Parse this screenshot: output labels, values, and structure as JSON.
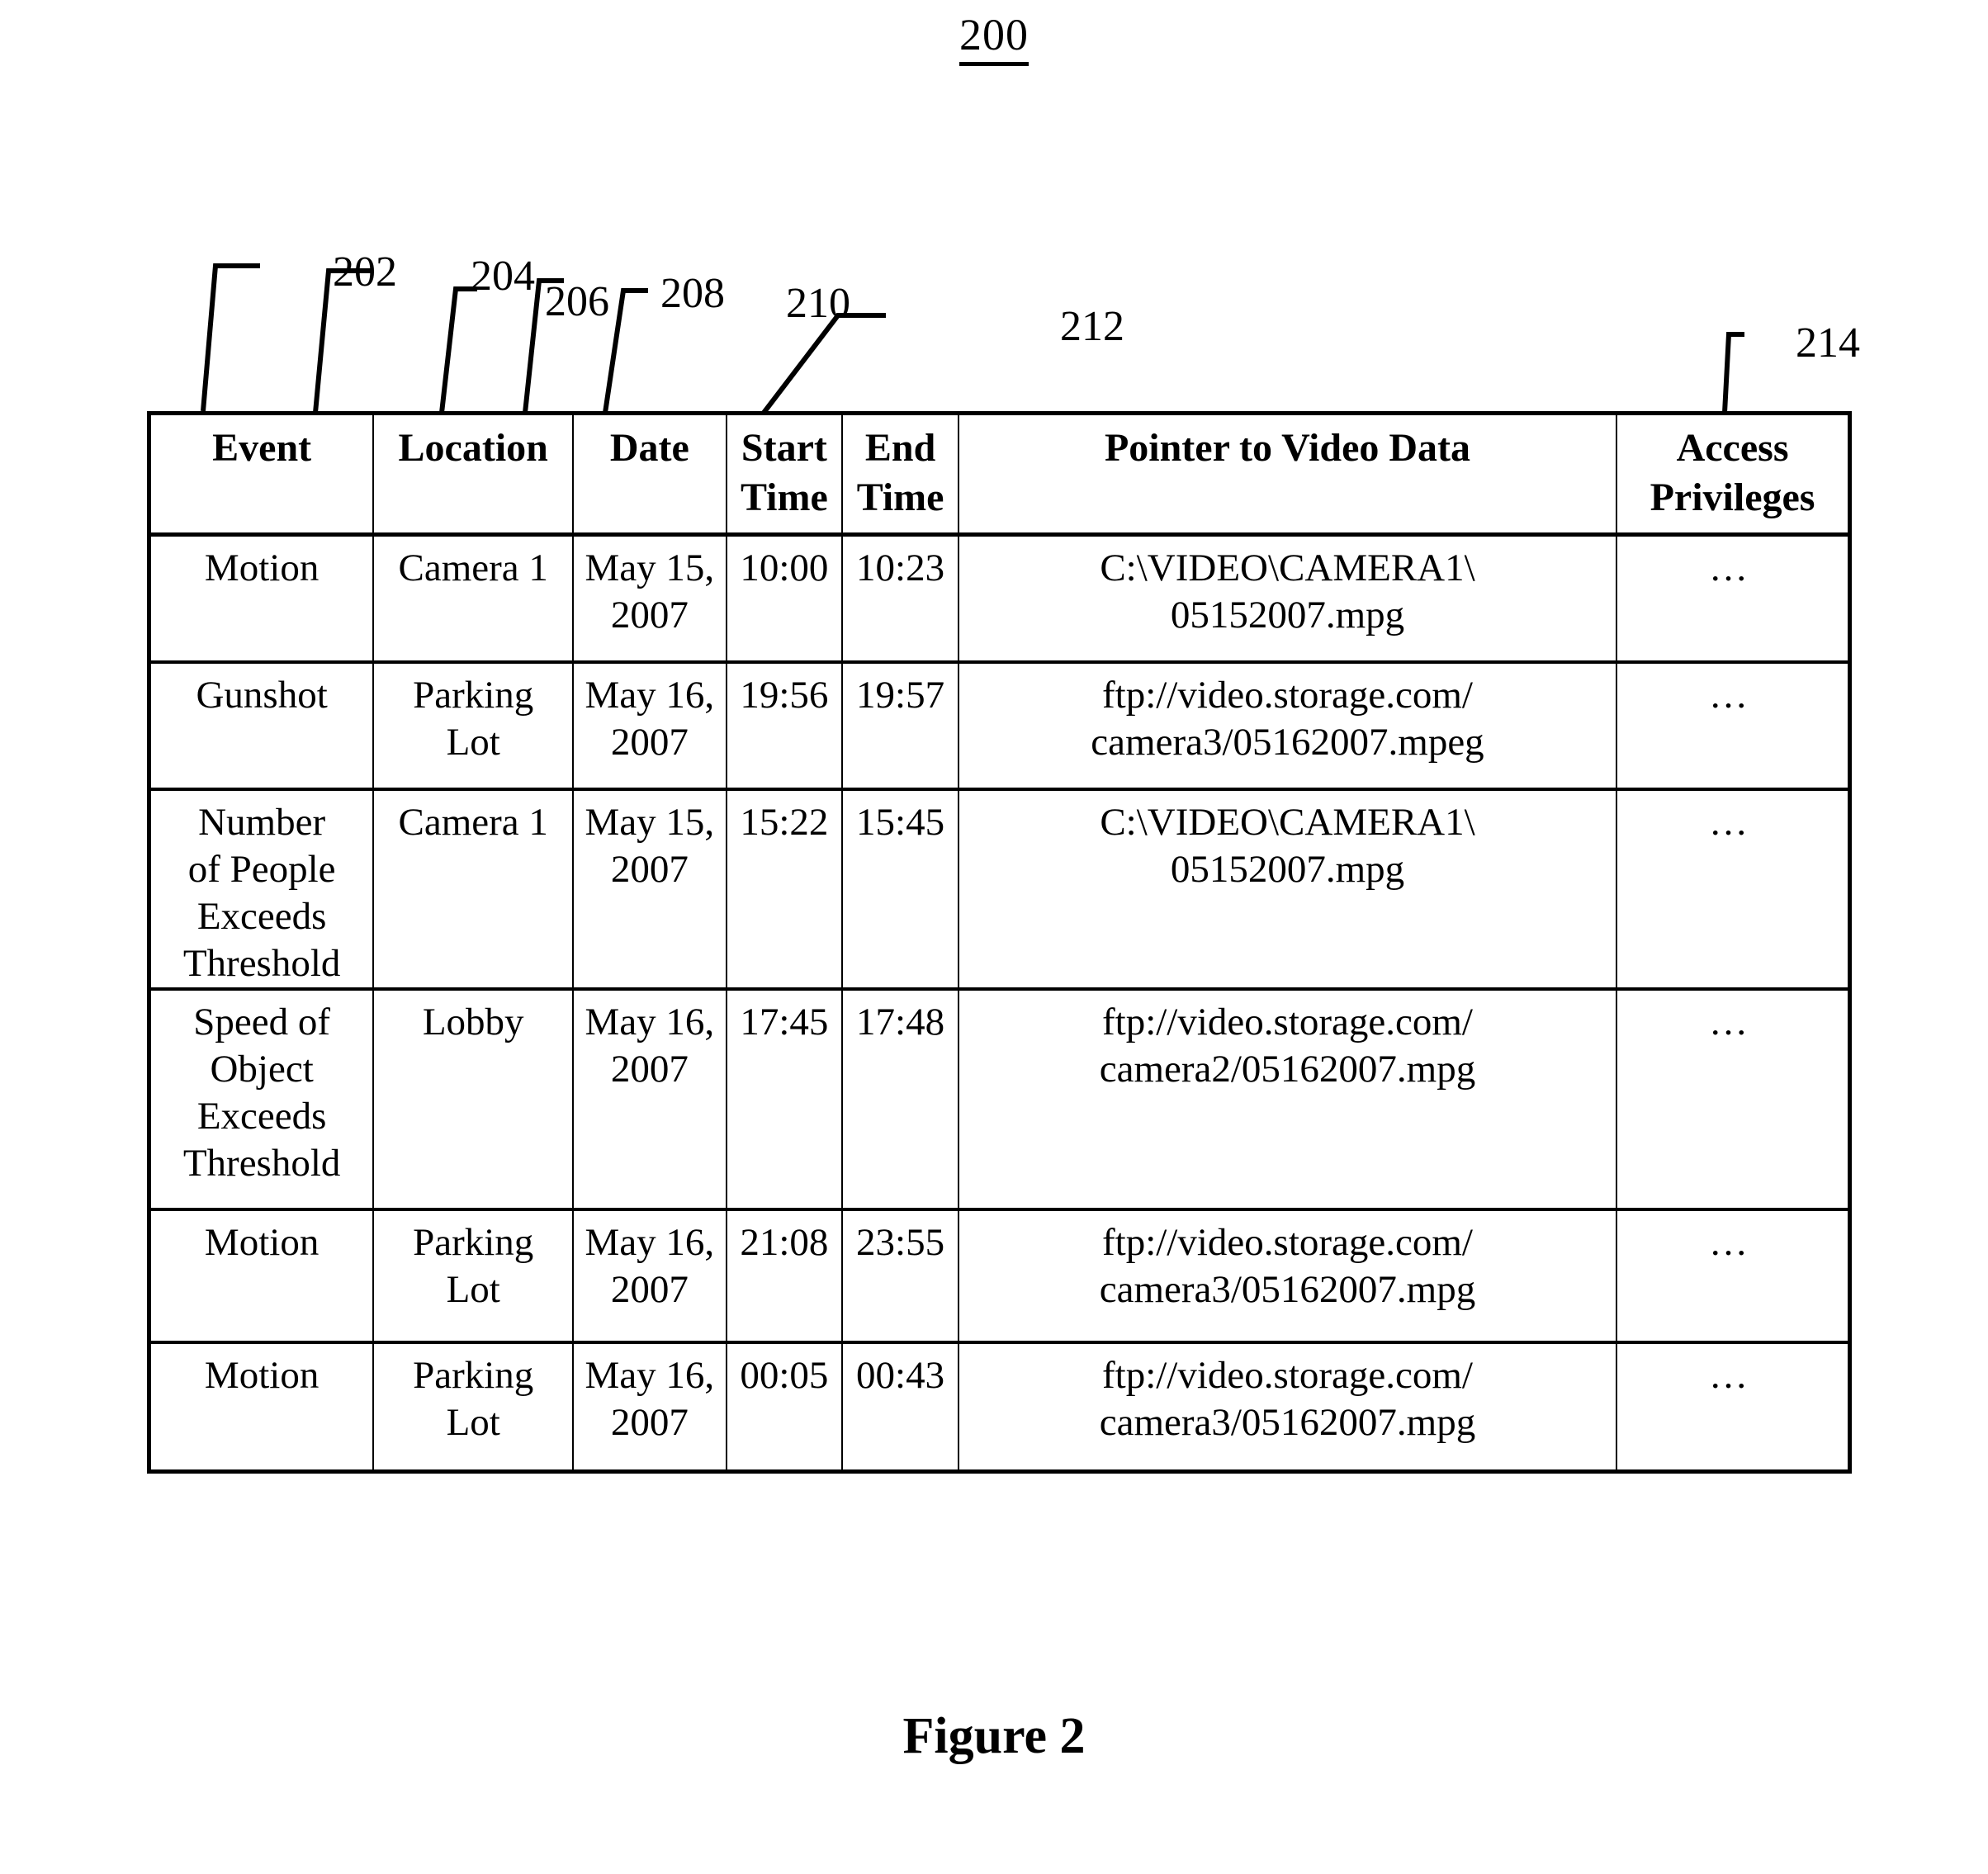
{
  "figure": {
    "number_label": "200",
    "caption": "Figure 2"
  },
  "reference_numerals": [
    {
      "id": "202",
      "label": "202"
    },
    {
      "id": "204",
      "label": "204"
    },
    {
      "id": "206",
      "label": "206"
    },
    {
      "id": "208",
      "label": "208"
    },
    {
      "id": "210",
      "label": "210"
    },
    {
      "id": "212",
      "label": "212"
    },
    {
      "id": "214",
      "label": "214"
    }
  ],
  "table": {
    "columns": [
      {
        "key": "event",
        "header_line1": "Event",
        "header_line2": ""
      },
      {
        "key": "location",
        "header_line1": "Location",
        "header_line2": ""
      },
      {
        "key": "date",
        "header_line1": "Date",
        "header_line2": ""
      },
      {
        "key": "start",
        "header_line1": "Start",
        "header_line2": "Time"
      },
      {
        "key": "end",
        "header_line1": "End",
        "header_line2": "Time"
      },
      {
        "key": "pointer",
        "header_line1": "Pointer to Video Data",
        "header_line2": ""
      },
      {
        "key": "access",
        "header_line1": "Access",
        "header_line2": "Privileges"
      }
    ],
    "rows": [
      {
        "event_lines": [
          "Motion"
        ],
        "location_lines": [
          "Camera 1"
        ],
        "date_lines": [
          "May 15,",
          "2007"
        ],
        "start": "10:00",
        "end": "10:23",
        "pointer_lines": [
          "C:\\VIDEO\\CAMERA1\\",
          "05152007.mpg"
        ],
        "access": "…"
      },
      {
        "event_lines": [
          "Gunshot"
        ],
        "location_lines": [
          "Parking",
          "Lot"
        ],
        "date_lines": [
          "May 16,",
          "2007"
        ],
        "start": "19:56",
        "end": "19:57",
        "pointer_lines": [
          "ftp://video.storage.com/",
          "camera3/05162007.mpeg"
        ],
        "access": "…"
      },
      {
        "event_lines": [
          "Number",
          "of People",
          "Exceeds",
          "Threshold"
        ],
        "location_lines": [
          "Camera 1"
        ],
        "date_lines": [
          "May 15,",
          "2007"
        ],
        "start": "15:22",
        "end": "15:45",
        "pointer_lines": [
          "C:\\VIDEO\\CAMERA1\\",
          "05152007.mpg"
        ],
        "access": "…"
      },
      {
        "event_lines": [
          "Speed of",
          "Object",
          "Exceeds",
          "Threshold"
        ],
        "location_lines": [
          "Lobby"
        ],
        "date_lines": [
          "May 16,",
          "2007"
        ],
        "start": "17:45",
        "end": "17:48",
        "pointer_lines": [
          "ftp://video.storage.com/",
          "camera2/05162007.mpg"
        ],
        "access": "…"
      },
      {
        "event_lines": [
          "Motion"
        ],
        "location_lines": [
          "Parking",
          "Lot"
        ],
        "date_lines": [
          "May 16,",
          "2007"
        ],
        "start": "21:08",
        "end": "23:55",
        "pointer_lines": [
          "ftp://video.storage.com/",
          "camera3/05162007.mpg"
        ],
        "access": "…"
      },
      {
        "event_lines": [
          "Motion"
        ],
        "location_lines": [
          "Parking",
          "Lot"
        ],
        "date_lines": [
          "May 16,",
          "2007"
        ],
        "start": "00:05",
        "end": "00:43",
        "pointer_lines": [
          "ftp://video.storage.com/",
          "camera3/05162007.mpg"
        ],
        "access": "…"
      }
    ]
  },
  "colors": {
    "ink": "#000000",
    "paper": "#ffffff"
  }
}
